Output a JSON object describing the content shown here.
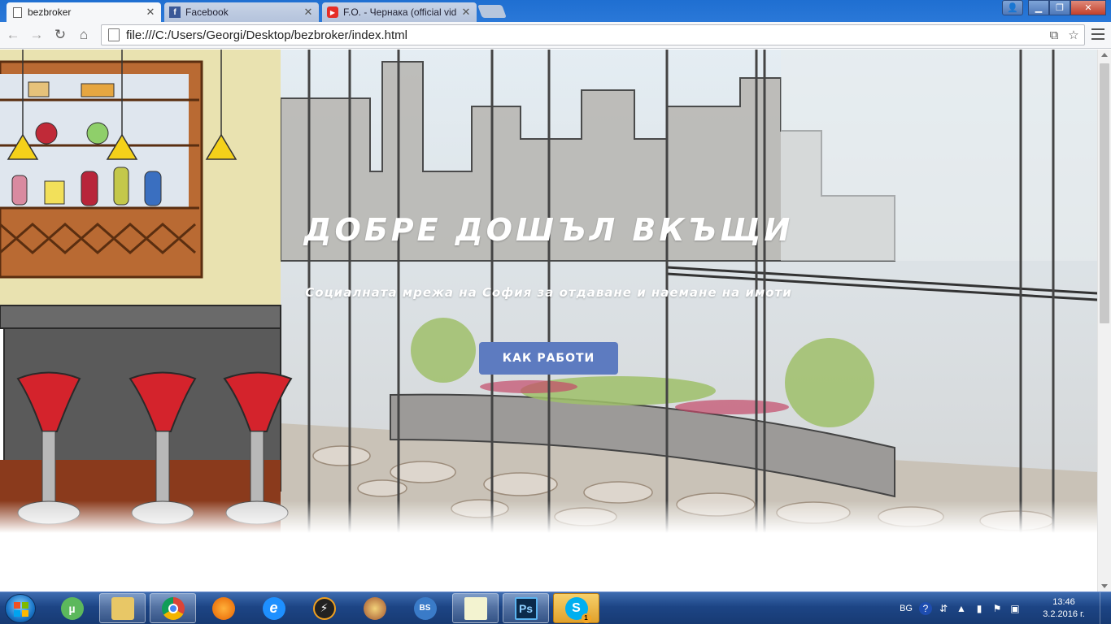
{
  "browser": {
    "tabs": [
      {
        "title": "bezbroker",
        "icon": "page-icon",
        "active": true
      },
      {
        "title": "Facebook",
        "icon": "facebook-icon",
        "active": false
      },
      {
        "title": "F.O. - Чернака (official vid",
        "icon": "youtube-icon",
        "active": false
      }
    ],
    "address": "file:///C:/Users/Georgi/Desktop/bezbroker/index.html"
  },
  "hero": {
    "title": "ДОБРЕ ДОШЪЛ ВКЪЩИ",
    "subtitle": "Социалната мрежа на София за отдаване и наемане на имоти",
    "button_label": "КАК РАБОТИ",
    "button_color": "#5d7bc0"
  },
  "taskbar": {
    "apps": [
      "utorrent-icon",
      "file-explorer-icon",
      "chrome-icon",
      "firefox-icon",
      "internet-explorer-icon",
      "winamp-icon",
      "game-icon",
      "ps-icon",
      "notepad-icon",
      "photoshop-icon",
      "skype-icon"
    ],
    "photoshop_label": "Ps",
    "skype_badge": "1",
    "language": "BG",
    "time": "13:46",
    "date": "3.2.2016 г."
  }
}
